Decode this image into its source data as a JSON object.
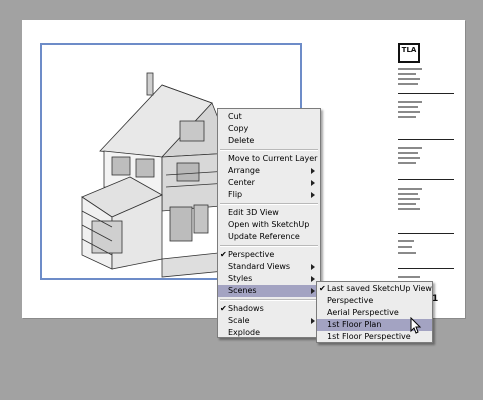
{
  "title_block": {
    "logo_text": "TLA"
  },
  "context_menu": {
    "items": [
      {
        "label": "Cut"
      },
      {
        "label": "Copy"
      },
      {
        "label": "Delete"
      },
      {
        "label": "Move to Current Layer"
      },
      {
        "label": "Arrange",
        "submenu": true
      },
      {
        "label": "Center",
        "submenu": true
      },
      {
        "label": "Flip",
        "submenu": true
      },
      {
        "label": "Edit 3D View"
      },
      {
        "label": "Open with SketchUp"
      },
      {
        "label": "Update Reference"
      },
      {
        "label": "Perspective",
        "checked": true
      },
      {
        "label": "Standard Views",
        "submenu": true
      },
      {
        "label": "Styles",
        "submenu": true
      },
      {
        "label": "Scenes",
        "submenu": true,
        "highlighted": true
      },
      {
        "label": "Shadows",
        "checked": true
      },
      {
        "label": "Scale",
        "submenu": true
      },
      {
        "label": "Explode"
      }
    ]
  },
  "scenes_submenu": {
    "items": [
      {
        "label": "Last saved SketchUp View",
        "checked": true
      },
      {
        "label": "Perspective"
      },
      {
        "label": "Aerial Perspective"
      },
      {
        "label": "1st Floor Plan",
        "highlighted": true
      },
      {
        "label": "1st Floor Perspective"
      }
    ]
  },
  "page_number_fragment": "1",
  "colors": {
    "background": "#a2a2a2",
    "viewport_border": "#6d8cc8",
    "highlight": "#a3a3c2",
    "menu_bg": "#ececec"
  }
}
